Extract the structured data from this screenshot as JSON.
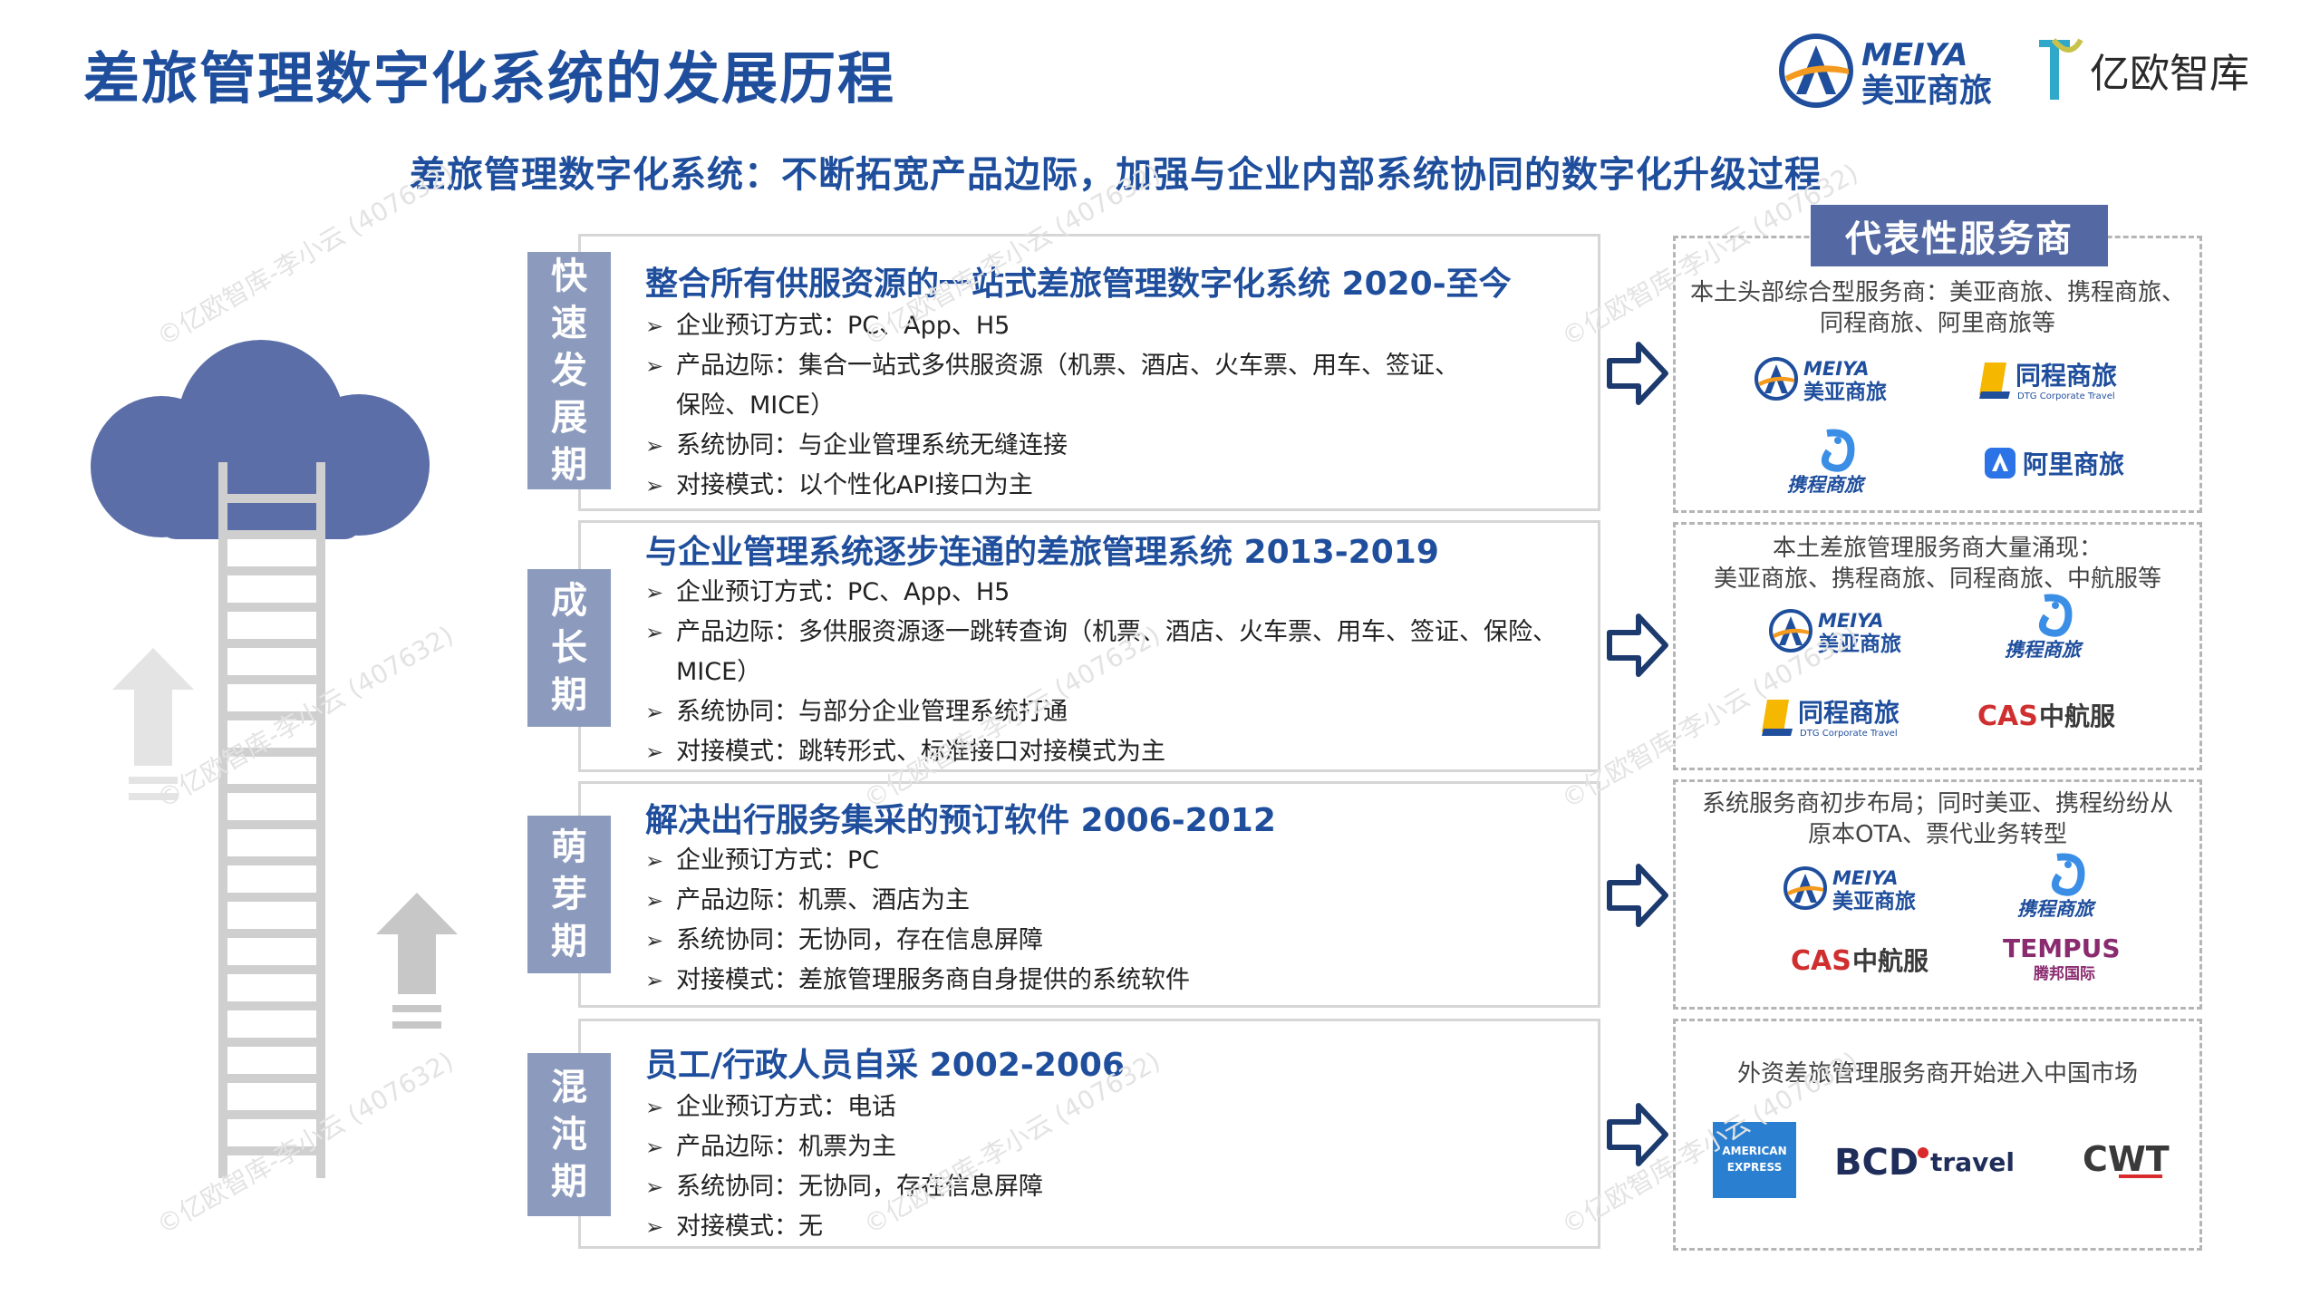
{
  "title": "差旅管理数字化系统的发展历程",
  "subtitle": "差旅管理数字化系统：不断拓宽产品边际，加强与企业内部系统协同的数字化升级过程",
  "brands": {
    "meiya_en": "MEIYA",
    "meiya_cn": "美亚商旅",
    "yiou": "亿欧智库"
  },
  "providers_header": "代表性服务商",
  "watermark": "©亿欧智库-李小云 (407632)",
  "stages": [
    {
      "tab": [
        "快",
        "速",
        "发",
        "展",
        "期"
      ],
      "title": "整合所有供服资源的一站式差旅管理数字化系统  2020-至今",
      "items": [
        "企业预订方式：PC、App、H5",
        "产品边际：集合一站式多供服资源（机票、酒店、火车票、用车、签证、",
        "系统协同：与企业管理系统无缝连接",
        "对接模式：以个性化API接口为主"
      ],
      "item2_cont": "保险、MICE）"
    },
    {
      "tab": [
        "成",
        "长",
        "期"
      ],
      "title": "与企业管理系统逐步连通的差旅管理系统  2013-2019",
      "items": [
        "企业预订方式：PC、App、H5",
        "产品边际：多供服资源逐一跳转查询（机票、酒店、火车票、用车、签证、保险、",
        "系统协同：与部分企业管理系统打通",
        "对接模式：跳转形式、标准接口对接模式为主"
      ],
      "item2_cont": "MICE）"
    },
    {
      "tab": [
        "萌",
        "芽",
        "期"
      ],
      "title": "解决出行服务集采的预订软件  2006-2012",
      "items": [
        "企业预订方式：PC",
        "产品边际：机票、酒店为主",
        "系统协同：无协同，存在信息屏障",
        "对接模式：差旅管理服务商自身提供的系统软件"
      ]
    },
    {
      "tab": [
        "混",
        "沌",
        "期"
      ],
      "title": "员工/行政人员自采  2002-2006",
      "items": [
        "企业预订方式：电话",
        "产品边际：机票为主",
        "系统协同：无协同，存在信息屏障",
        "对接模式：无"
      ]
    }
  ],
  "provider_panels": [
    {
      "note": [
        "本土头部综合型服务商：美亚商旅、携程商旅、",
        "同程商旅、阿里商旅等"
      ],
      "logos": {
        "meiya_en": "MEIYA",
        "meiya_cn": "美亚商旅",
        "tongcheng": "同程商旅",
        "tongcheng_en": "DTG Corporate Travel",
        "ctrip": "携程商旅",
        "ali": "阿里商旅"
      }
    },
    {
      "note": [
        "本土差旅管理服务商大量涌现：",
        "美亚商旅、携程商旅、同程商旅、中航服等"
      ],
      "logos": {
        "meiya_en": "MEIYA",
        "meiya_cn": "美亚商旅",
        "ctrip": "携程商旅",
        "tongcheng": "同程商旅",
        "tongcheng_en": "DTG Corporate Travel",
        "cas": "CAS",
        "cas_cn": "中航服"
      }
    },
    {
      "note": [
        "系统服务商初步布局；同时美亚、携程纷纷从",
        "原本OTA、票代业务转型"
      ],
      "logos": {
        "meiya_en": "MEIYA",
        "meiya_cn": "美亚商旅",
        "ctrip": "携程商旅",
        "cas": "CAS",
        "cas_cn": "中航服",
        "tempus": "TEMPUS",
        "tempus_cn": "腾邦国际"
      }
    },
    {
      "note": [
        "外资差旅管理服务商开始进入中国市场"
      ],
      "logos": {
        "amex_1": "AMERICAN",
        "amex_2": "EXPRESS",
        "bcd": "BCD",
        "bcd_travel": "travel",
        "cwt": "CWT"
      }
    }
  ],
  "colors": {
    "title_blue": "#1f4e9d",
    "tab_gray_blue": "#8c9bbd",
    "header_blue": "#5469a3",
    "cloud": "#5b6ea8",
    "ladder": "#cfcfcf"
  }
}
